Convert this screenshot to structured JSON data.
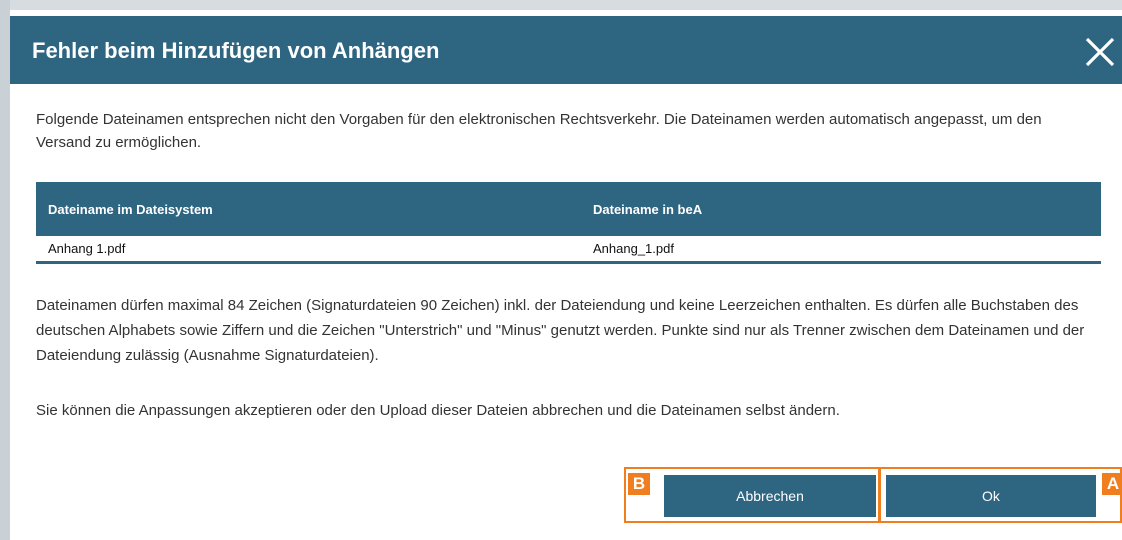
{
  "dialog": {
    "title": "Fehler beim Hinzufügen von Anhängen",
    "close_icon": "close-icon",
    "intro": "Folgende Dateinamen entsprechen nicht den Vorgaben für den elektronischen Rechtsverkehr. Die Dateinamen werden automatisch angepasst, um den Versand zu ermöglichen.",
    "table": {
      "headers": [
        "Dateiname im Dateisystem",
        "Dateiname in beA"
      ],
      "rows": [
        [
          "Anhang 1.pdf",
          "Anhang_1.pdf"
        ]
      ]
    },
    "rules": "Dateinamen dürfen maximal 84 Zeichen (Signaturdateien 90 Zeichen) inkl. der Dateiendung und keine Leerzeichen enthalten. Es dürfen alle Buchstaben des deutschen Alphabets sowie Ziffern und die Zeichen \"Unterstrich\" und \"Minus\" genutzt werden. Punkte sind nur als Trenner zwischen dem Dateinamen und der Dateiendung zulässig (Ausnahme Signaturdateien).",
    "hint": "Sie können die Anpassungen akzeptieren oder den Upload dieser Dateien abbrechen und die Dateinamen selbst ändern.",
    "buttons": {
      "cancel": "Abbrechen",
      "ok": "Ok"
    },
    "annotations": {
      "b": "B",
      "a": "A"
    }
  },
  "colors": {
    "header_bg": "#2e6581",
    "highlight": "#f07d1e"
  }
}
